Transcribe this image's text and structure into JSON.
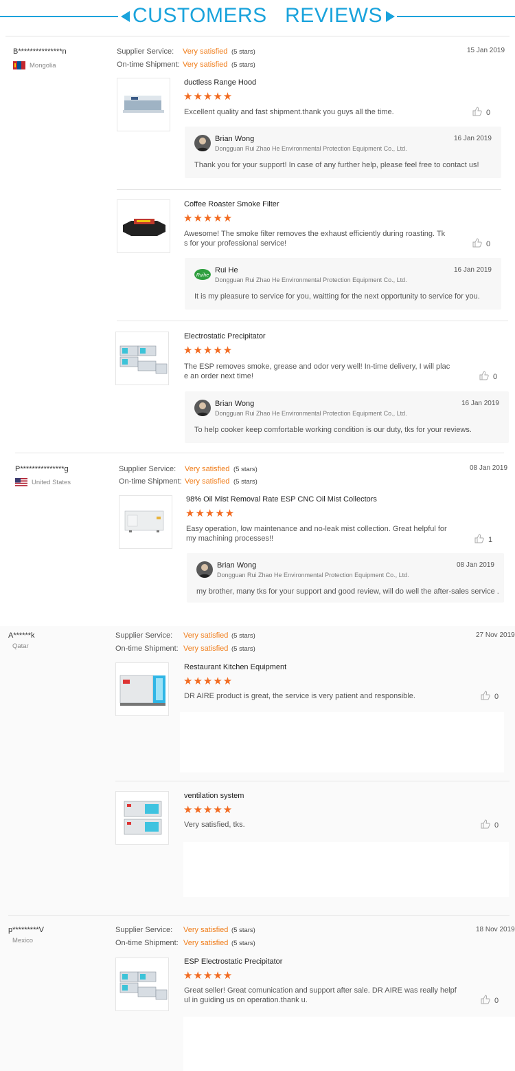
{
  "header": {
    "title": "CUSTOMERS   REVIEWS",
    "accent": "#1aa3dc"
  },
  "common": {
    "supplier_label": "Supplier Service:",
    "shipment_label": "On-time Shipment:",
    "rating_value": "Very satisfied",
    "rating_stars": "(5 stars)",
    "stars_glyph": "★★★★★",
    "star_color": "#f26b21",
    "value_color": "#f07d1a",
    "company": "Dongguan Rui Zhao He Environmental Protection Equipment Co., Ltd."
  },
  "customers": [
    {
      "name": "B***************n",
      "country": "Mongolia",
      "date": "15 Jan 2019",
      "products": [
        {
          "title": "ductless Range Hood",
          "review": "Excellent quality and fast shipment.thank you guys all the time.",
          "likes": "0",
          "reply": {
            "name": "Brian Wong",
            "date": "16 Jan 2019",
            "text": "Thank you  for your support! In case of any further help, please feel free to contact us!"
          }
        },
        {
          "title": "Coffee Roaster Smoke Filter",
          "review_lines": [
            "Awesome! The smoke filter removes the exhaust efficiently during roasting. Tk",
            "s for your professional service!"
          ],
          "likes": "0",
          "reply": {
            "name": "Rui He",
            "date": "16 Jan 2019",
            "text": "It is my pleasure to service for you, waitting for the next opportunity to service for you."
          }
        },
        {
          "title": "Electrostatic Precipitator",
          "review_lines": [
            "The ESP removes smoke, grease and odor very well!  In-time delivery, I will plac",
            "e an order next time!"
          ],
          "likes": "0",
          "reply": {
            "name": "Brian Wong",
            "date": "16 Jan 2019",
            "text": "To help cooker keep comfortable  working condition is our duty, tks for your reviews."
          }
        }
      ]
    },
    {
      "name": "P***************g",
      "country": "United States",
      "date": "08 Jan 2019",
      "products": [
        {
          "title": "98% Oil Mist Removal Rate ESP CNC Oil Mist Collectors",
          "review_lines": [
            "Easy operation, low maintenance and no-leak mist collection. Great helpful for",
            "my machining processes!!"
          ],
          "likes": "1",
          "reply": {
            "name": "Brian Wong",
            "date": "08 Jan 2019",
            "text": "my brother, many tks for your support and good review, will do well the after-sales service ."
          }
        }
      ]
    },
    {
      "name": "A******k",
      "country": "Qatar",
      "date": "27 Nov 2019",
      "products": [
        {
          "title": "Restaurant Kitchen Equipment",
          "review": "DR AIRE product is great, the service is very patient and responsible.",
          "likes": "0"
        },
        {
          "title": "ventilation system",
          "review": "Very satisfied, tks.",
          "likes": "0"
        }
      ]
    },
    {
      "name": "p*********V",
      "country": "Mexico",
      "date": "18 Nov 2019",
      "products": [
        {
          "title": "ESP Electrostatic Precipitator",
          "review_lines": [
            "Great seller! Great comunication  and support after sale. DR AIRE was really helpf",
            "ul in guiding us on operation.thank u."
          ],
          "likes": "0"
        }
      ]
    }
  ]
}
